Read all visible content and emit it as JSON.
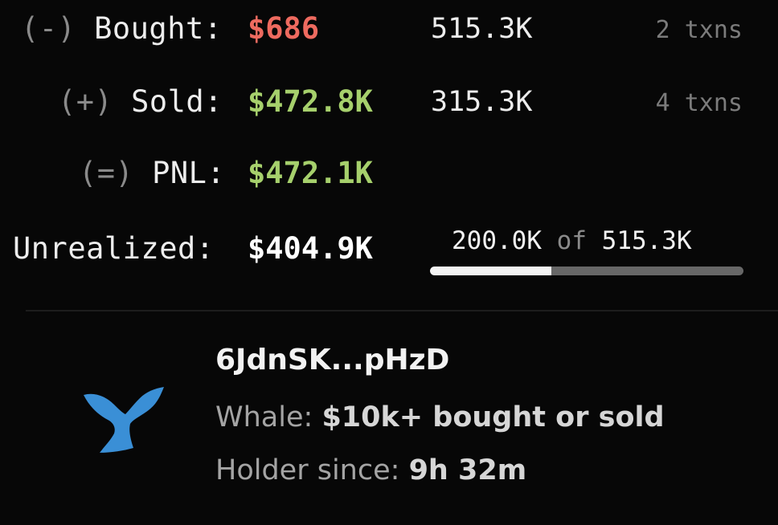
{
  "rows": {
    "bought": {
      "sign": "(-)",
      "label": "Bought:",
      "amount": "$686",
      "tokens": "515.3K",
      "txns": "2 txns"
    },
    "sold": {
      "sign": "(+)",
      "label": "Sold:",
      "amount": "$472.8K",
      "tokens": "315.3K",
      "txns": "4 txns"
    },
    "pnl": {
      "sign": "(=)",
      "label": "PNL:",
      "amount": "$472.1K"
    },
    "unrealized": {
      "label": "Unrealized:",
      "amount": "$404.9K",
      "held": "200.0K",
      "of_word": "of",
      "total": "515.3K",
      "held_fraction": 0.3881
    }
  },
  "holder": {
    "icon": "whale-tail-icon",
    "wallet": "6JdnSK...pHzD",
    "tag_label": "Whale:",
    "tag_value": "$10k+ bought or sold",
    "since_label": "Holder since:",
    "since_value": "9h 32m"
  },
  "colors": {
    "loss": "#ee6a5f",
    "profit": "#a6d06c",
    "whale": "#3a8fd6"
  }
}
